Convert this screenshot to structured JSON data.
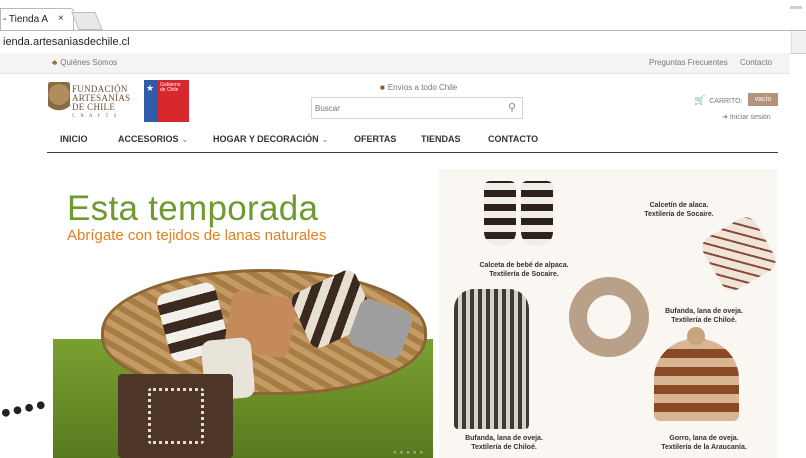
{
  "browser": {
    "tab_title": "- Tienda A",
    "tab_close": "×",
    "address": "ienda.artesaniasdechile.cl"
  },
  "topbar": {
    "left_link": "Quiénes Somos",
    "right_links": [
      "Preguntas Frecuentes",
      "Contacto"
    ]
  },
  "header": {
    "logo_lines": [
      "FUNDACIÓN",
      "ARTESANÍAS",
      "DE CHILE",
      "C R A F T S"
    ],
    "gob_text": [
      "Gobierno",
      "de Chile"
    ],
    "shipping": "Envíos a todo Chile",
    "search_placeholder": "Buscar",
    "cart_label": "CARRITO:",
    "cart_badge": "vacío",
    "login": "Iniciar sesión"
  },
  "nav": {
    "items": [
      {
        "label": "INICIO"
      },
      {
        "label": "ACCESORIOS"
      },
      {
        "label": "HOGAR Y DECORACIÓN"
      },
      {
        "label": "OFERTAS"
      },
      {
        "label": "TIENDAS"
      },
      {
        "label": "CONTACTO"
      }
    ]
  },
  "banner": {
    "headline": "Esta temporada",
    "subline": "Abrígate con tejidos de lanas naturales",
    "captions": [
      "Calceta de bebé de alpaca.\nTextilería de Socaire.",
      "Calcetín de alaca.\nTextilería de Socaire.",
      "Bufanda, lana de oveja.\nTextilería de Chiloé.",
      "Bufanda, lana de oveja.\nTextilería de Chiloé.",
      "Gorro, lana de oveja.\nTextilería de la Araucanía."
    ]
  },
  "colors": {
    "headline_green": "#6e9a2e",
    "subline_orange": "#e0801f",
    "cart_badge": "#b5937a",
    "nav_border": "#4a3a2a"
  }
}
